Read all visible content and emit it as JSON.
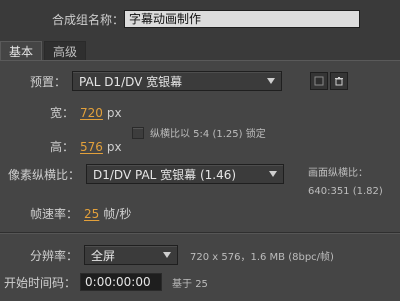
{
  "header": {
    "label": "合成组名称：",
    "value": "字幕动画制作"
  },
  "tabs": [
    {
      "label": "基本"
    },
    {
      "label": "高级"
    }
  ],
  "preset": {
    "label": "预置：",
    "value": "PAL D1/DV 宽银幕"
  },
  "width": {
    "label": "宽：",
    "value": "720",
    "unit": "px"
  },
  "height": {
    "label": "高：",
    "value": "576",
    "unit": "px"
  },
  "lock_aspect": {
    "label": "纵横比以 5:4 (1.25) 锁定"
  },
  "pixel_aspect": {
    "label": "像素纵横比：",
    "value": "D1/DV PAL 宽银幕 (1.46)",
    "frame_aspect_label": "画面纵横比：",
    "frame_aspect_value": "640:351 (1.82)"
  },
  "frame_rate": {
    "label": "帧速率：",
    "value": "25",
    "unit": "帧/秒"
  },
  "resolution": {
    "label": "分辨率：",
    "value": "全屏",
    "info": "720 x 576，1.6 MB (8bpc/帧)"
  },
  "start_timecode": {
    "label": "开始时间码：",
    "value": "0:00:00:00",
    "base": "基于 25"
  },
  "colors": {
    "accent_orange": "#e2a03b",
    "panel_bg": "#454545",
    "window_bg": "#3a3a3a"
  }
}
